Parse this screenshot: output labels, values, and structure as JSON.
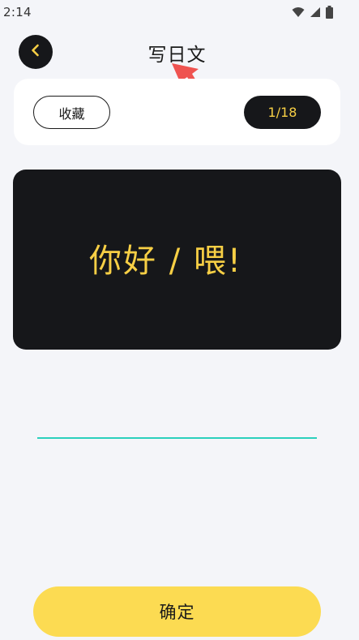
{
  "status_bar": {
    "time": "2:14",
    "icons": [
      "wifi-icon",
      "cellular-signal-icon",
      "battery-icon"
    ]
  },
  "header": {
    "title": "写日文",
    "back_icon": "chevron-left-icon"
  },
  "top_card": {
    "favorite_label": "收藏",
    "progress_label": "1/18"
  },
  "word_card": {
    "text": "你好 / 喂!"
  },
  "answer": {
    "value": "",
    "placeholder": ""
  },
  "confirm_label": "确定",
  "colors": {
    "background": "#f4f5f9",
    "dark": "#16171a",
    "accent_yellow": "#f7cf45",
    "button_yellow": "#fcdb52",
    "input_underline": "#2bd0bd",
    "annotation_arrow": "#ef5350"
  }
}
